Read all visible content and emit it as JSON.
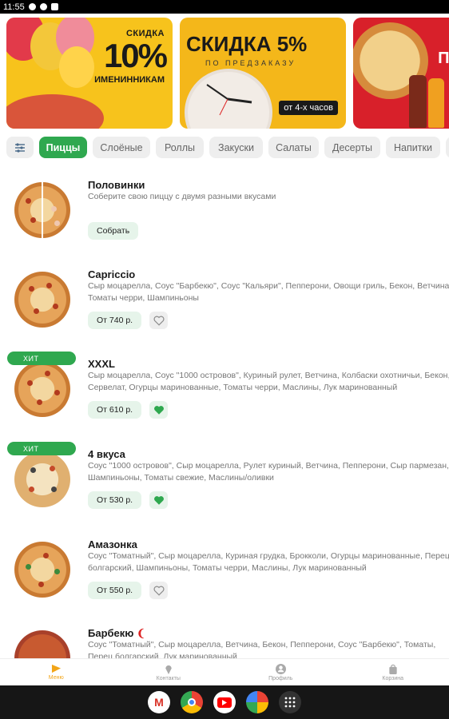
{
  "status_bar": {
    "time": "11:55"
  },
  "banners": [
    {
      "line1": "СКИДКА",
      "line2": "10%",
      "line3": "ИМЕНИННИКАМ"
    },
    {
      "line1": "СКИДКА 5%",
      "line2": "ПО ПРЕДЗАКАЗУ",
      "line3": "от 4-х часов"
    },
    {
      "line1": "ПО"
    }
  ],
  "categories": [
    "Пиццы",
    "Слоёные",
    "Роллы",
    "Закуски",
    "Салаты",
    "Десерты",
    "Напитки"
  ],
  "products": [
    {
      "title": "Половинки",
      "description": [
        "Соберите свою пиццу с двумя разными вкусами"
      ],
      "action": "Собрать",
      "hit": false
    },
    {
      "title": "Capriccio",
      "description": [
        "Сыр моцарелла, Соус \"Барбекю\", Соус \"Кальяри\", Пепперони, Овощи гриль, Бекон, Ветчина,",
        "Томаты черри, Шампиньоны"
      ],
      "price": "От 740 р.",
      "hit": false,
      "favorite": false
    },
    {
      "title": "XXXL",
      "badge": "ХИТ",
      "description": [
        "Сыр моцарелла, Соус \"1000 островов\", Куриный рулет, Ветчина, Колбаски охотничьи, Бекон,",
        "Сервелат, Огурцы маринованные, Томаты черри, Маслины, Лук маринованный"
      ],
      "price": "От 610 р.",
      "hit": true,
      "favorite": true
    },
    {
      "title": "4 вкуса",
      "badge": "ХИТ",
      "description": [
        "Соус \"1000 островов\", Сыр моцарелла, Рулет куриный, Ветчина, Пепперони, Сыр пармезан,",
        "Шампиньоны, Томаты свежие, Маслины/оливки"
      ],
      "price": "От 530 р.",
      "hit": true,
      "favorite": true
    },
    {
      "title": "Амазонка",
      "description": [
        "Соус \"Томатный\", Сыр моцарелла, Куриная грудка, Брокколи, Огурцы маринованные, Перец",
        "болгарский, Шампиньоны, Томаты черри, Маслины, Лук маринованный"
      ],
      "price": "От 550 р.",
      "hit": false,
      "favorite": false
    },
    {
      "title": "Барбекю",
      "description": [
        "Соус \"Томатный\", Сыр моцарелла, Ветчина, Бекон, Пепперони, Соус \"Барбекю\", Томаты,",
        "Перец болгарский, Лук маринованный"
      ],
      "hit": false
    }
  ],
  "bottom_nav": {
    "menu": "Меню",
    "contacts": "Контакты",
    "profile": "Профиль",
    "cart": "Корзина"
  },
  "colors": {
    "accent": "#2fa84f",
    "nav_active": "#f2a518"
  },
  "taskbar_apps": [
    "gmail-icon",
    "chrome-icon",
    "youtube-icon",
    "photos-icon",
    "app-drawer-icon"
  ]
}
